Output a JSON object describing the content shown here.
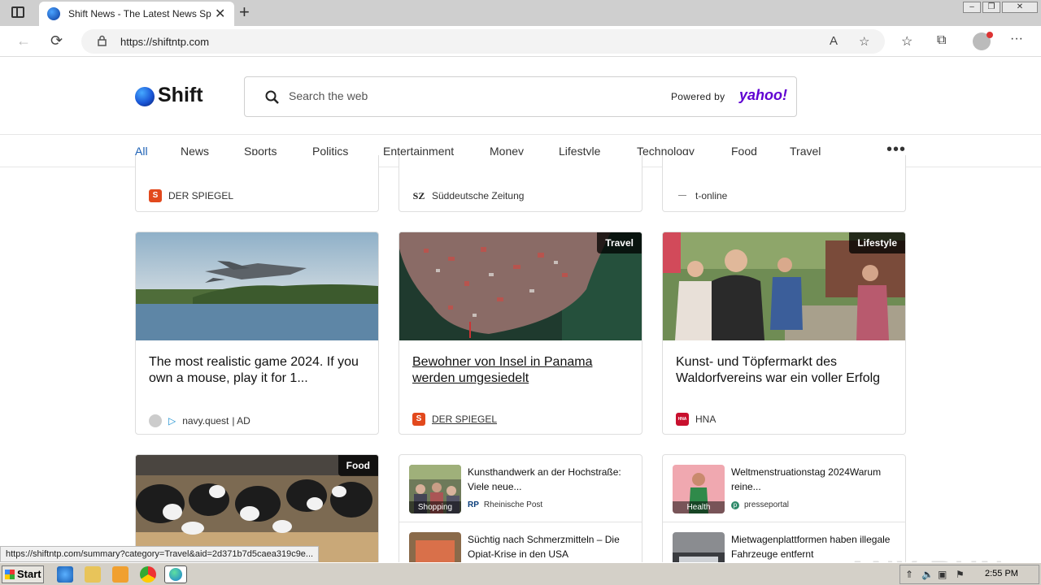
{
  "browser": {
    "tab_title": "Shift News - The Latest News Sports",
    "tab_close": "✕",
    "new_tab": "+",
    "url": "https://shiftntp.com",
    "back": "←",
    "reload": "⟳",
    "more": "···"
  },
  "site": {
    "logo": "Shift",
    "search_placeholder": "Search the web",
    "powered_by": "Powered by",
    "search_partner": "yahoo!"
  },
  "nav": {
    "items": [
      "All",
      "News",
      "Sports",
      "Politics",
      "Entertainment",
      "Money",
      "Lifestyle",
      "Technology",
      "Food",
      "Travel"
    ],
    "active": "All",
    "more": "•••"
  },
  "top_row": [
    {
      "source": "DER SPIEGEL",
      "logo_letter": "S",
      "logo_color": "#e2491d"
    },
    {
      "source": "Süddeutsche Zeitung",
      "logo_letter": "SZ",
      "logo_color": "#222222"
    },
    {
      "source": "t-online",
      "logo_letter": "—",
      "logo_color": "#888888"
    }
  ],
  "cards": [
    {
      "headline": "The most realistic game 2024. If you own a mouse, play it for 1...",
      "source": "navy.quest",
      "ad": "| AD",
      "tag": ""
    },
    {
      "headline": "Bewohner von Insel in Panama werden umgesiedelt",
      "source": "DER SPIEGEL",
      "tag": "Travel",
      "logo_letter": "S"
    },
    {
      "headline": "Kunst- und Töpfermarkt des Waldorfvereins war ein voller Erfolg",
      "source": "HNA",
      "tag": "Lifestyle",
      "logo_letter": "HNA"
    }
  ],
  "bottom": {
    "food_tag": "Food",
    "mini_left": [
      {
        "title": "Kunsthandwerk an der Hochstraße: Viele neue...",
        "label": "Shopping",
        "source": "Rheinische Post",
        "logo": "RP"
      },
      {
        "title": "Süchtig nach Schmerzmitteln – Die Opiat-Krise in den USA",
        "label": "",
        "source": "",
        "logo": ""
      }
    ],
    "mini_right": [
      {
        "title": "Weltmenstruationstag 2024Warum reine...",
        "label": "Health",
        "source": "presseportal",
        "logo": "p"
      },
      {
        "title": "Mietwagenplattformen haben illegale Fahrzeuge entfernt",
        "label": "",
        "source": "",
        "logo": ""
      }
    ]
  },
  "status_url": "https://shiftntp.com/summary?category=Travel&aid=2d371b7d5caea319c9e...",
  "watermark": "ANY RUN",
  "taskbar": {
    "start": "Start",
    "clock": "2:55 PM"
  },
  "colors": {
    "accent": "#1a5fb4",
    "yahoo": "#6001d2",
    "spiegel": "#e2491d",
    "hna": "#c8102e"
  }
}
